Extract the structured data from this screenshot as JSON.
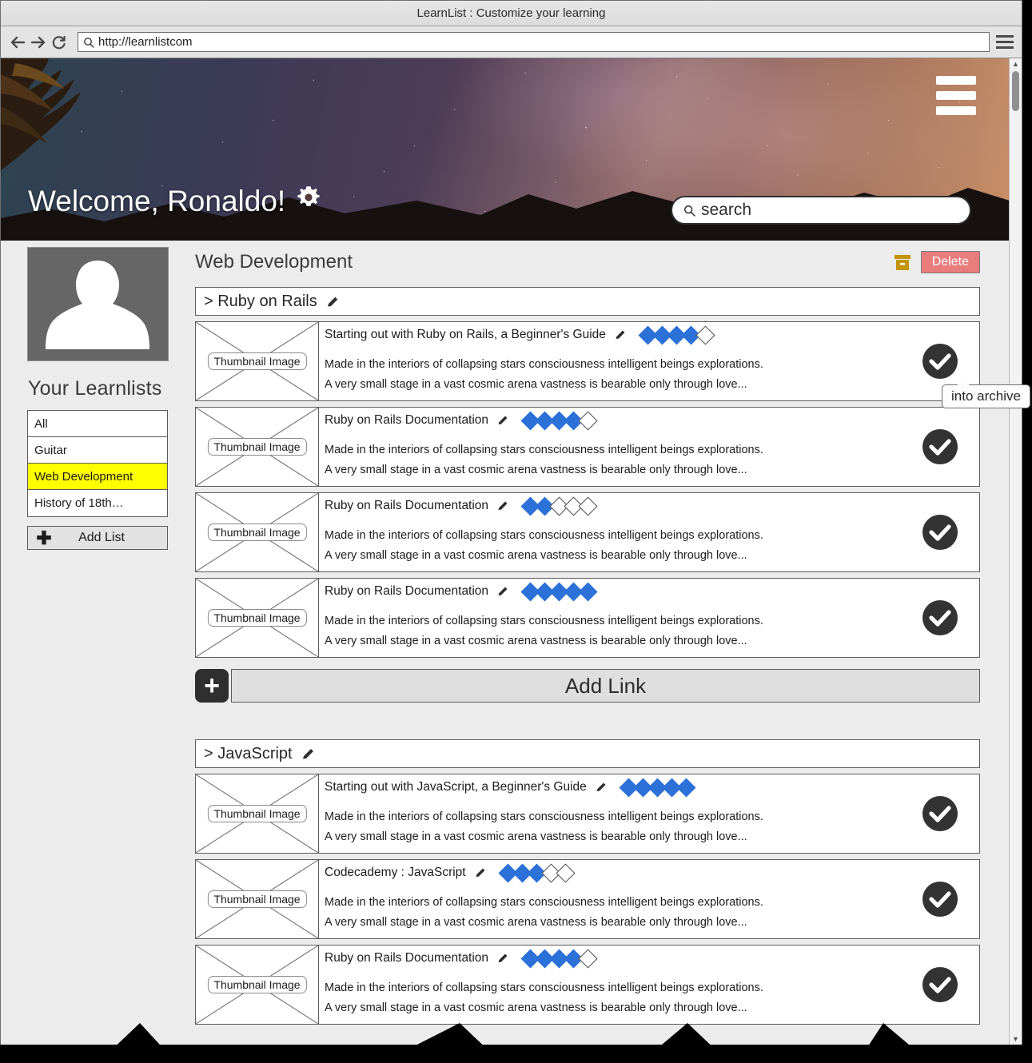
{
  "browser": {
    "window_title": "LearnList : Customize your learning",
    "url": "http://learnlistcom",
    "back_icon": "back-arrow-icon",
    "forward_icon": "forward-arrow-icon",
    "reload_icon": "reload-icon",
    "menu_icon": "browser-menu-icon"
  },
  "hero": {
    "welcome_text": "Welcome, Ronaldo!",
    "settings_icon": "gear-icon",
    "menu_icon": "hamburger-menu-icon",
    "search_placeholder": "search",
    "search_value": "",
    "search_icon": "search-icon"
  },
  "sidebar": {
    "avatar_alt": "user-avatar",
    "heading": "Your Learnlists",
    "items": [
      {
        "label": "All",
        "active": false
      },
      {
        "label": "Guitar",
        "active": false
      },
      {
        "label": "Web Development",
        "active": true
      },
      {
        "label": "History of 18th…",
        "active": false
      }
    ],
    "add_list_label": "Add List",
    "add_list_icon": "plus-icon",
    "highlight_color": "#ffff00"
  },
  "main": {
    "page_title": "Web Development",
    "archive_icon": "archive-box-icon",
    "archive_color": "#c39308",
    "delete_label": "Delete",
    "delete_color": "#e97c7c",
    "edit_icon": "pencil-icon",
    "check_icon": "check-circle-icon",
    "thumbnail_label": "Thumbnail Image",
    "add_link_label": "Add Link",
    "add_link_icon": "plus-icon",
    "rating_max": 5,
    "rating_filled_color": "#2b71d8",
    "tooltip": {
      "text": "into archive",
      "target": "check-circle-icon"
    },
    "sections": [
      {
        "title": "> Ruby on Rails",
        "links": [
          {
            "title": "Starting out with Ruby on Rails, a Beginner's Guide",
            "rating": 4,
            "desc_line1": "Made in the interiors of collapsing stars consciousness intelligent beings explorations.",
            "desc_line2": "A very small stage in a vast cosmic arena vastness is bearable only through love..."
          },
          {
            "title": "Ruby on Rails Documentation",
            "rating": 4,
            "desc_line1": "Made in the interiors of collapsing stars consciousness intelligent beings explorations.",
            "desc_line2": "A very small stage in a vast cosmic arena vastness is bearable only through love..."
          },
          {
            "title": "Ruby on Rails Documentation",
            "rating": 2,
            "desc_line1": "Made in the interiors of collapsing stars consciousness intelligent beings explorations.",
            "desc_line2": "A very small stage in a vast cosmic arena vastness is bearable only through love..."
          },
          {
            "title": "Ruby on Rails Documentation",
            "rating": 5,
            "desc_line1": "Made in the interiors of collapsing stars consciousness intelligent beings explorations.",
            "desc_line2": "A very small stage in a vast cosmic arena vastness is bearable only through love..."
          }
        ],
        "has_add_link": true
      },
      {
        "title": "> JavaScript",
        "links": [
          {
            "title": "Starting out with JavaScript, a Beginner's Guide",
            "rating": 5,
            "desc_line1": "Made in the interiors of collapsing stars consciousness intelligent beings explorations.",
            "desc_line2": "A very small stage in a vast cosmic arena vastness is bearable only through love..."
          },
          {
            "title": "Codecademy : JavaScript",
            "rating": 3,
            "desc_line1": "Made in the interiors of collapsing stars consciousness intelligent beings explorations.",
            "desc_line2": "A very small stage in a vast cosmic arena vastness is bearable only through love..."
          },
          {
            "title": "Ruby on Rails Documentation",
            "rating": 4,
            "desc_line1": "Made in the interiors of collapsing stars consciousness intelligent beings explorations.",
            "desc_line2": "A very small stage in a vast cosmic arena vastness is bearable only through love..."
          }
        ],
        "has_add_link": false
      }
    ]
  }
}
